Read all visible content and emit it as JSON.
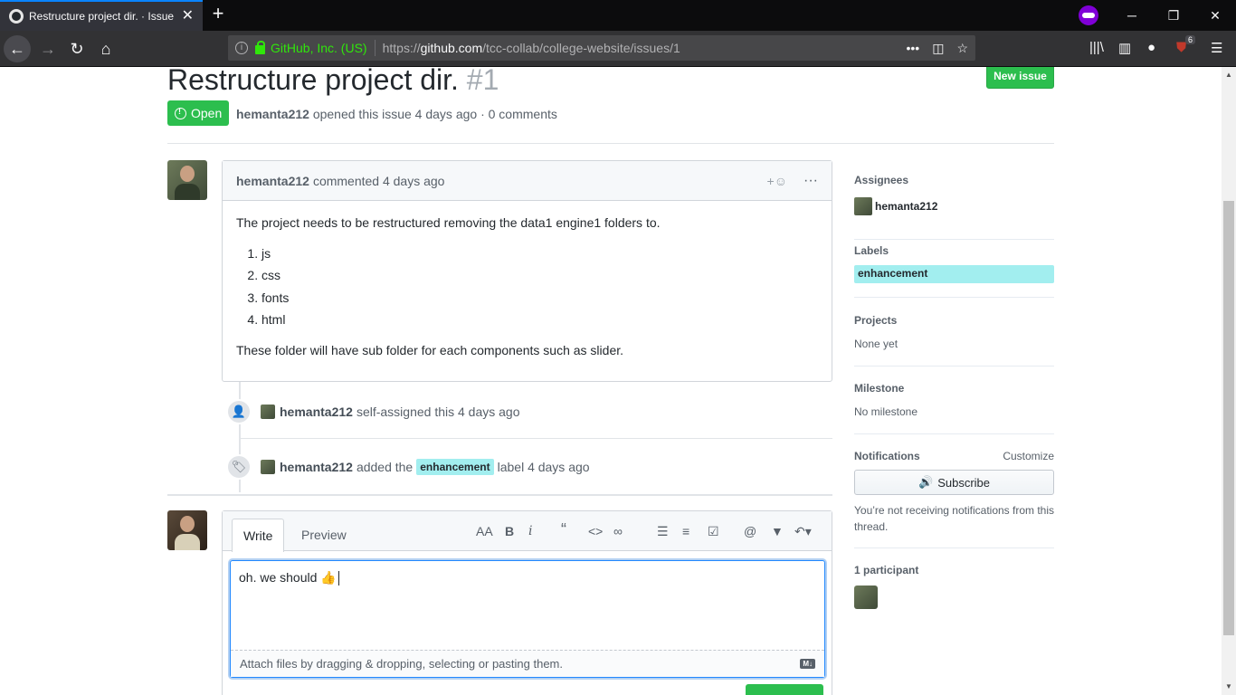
{
  "browser": {
    "tab_title": "Restructure project dir. · Issue #",
    "url_identity": "GitHub, Inc. (US)",
    "url_prefix": "https://",
    "url_host": "github.com",
    "url_path": "/tcc-collab/college-website/issues/1",
    "addon_badge": "6"
  },
  "issue": {
    "title": "Restructure project dir.",
    "number": "#1",
    "new_issue_label": "New issue",
    "state": "Open",
    "author": "hemanta212",
    "meta": "opened this issue 4 days ago · 0 comments"
  },
  "comment": {
    "author": "hemanta212",
    "action": "commented 4 days ago",
    "intro": "The project needs to be restructured removing the data1 engine1 folders to.",
    "items": [
      "js",
      "css",
      "fonts",
      "html"
    ],
    "outro": "These folder will have sub folder for each components such as slider."
  },
  "events": [
    {
      "author": "hemanta212",
      "text": "self-assigned this 4 days ago"
    },
    {
      "author": "hemanta212",
      "pre": "added the",
      "label": "enhancement",
      "post": "label 4 days ago"
    }
  ],
  "composer": {
    "tab_write": "Write",
    "tab_preview": "Preview",
    "text": "oh. we should 👍",
    "attach": "Attach files by dragging & dropping, selecting or pasting them."
  },
  "sidebar": {
    "assignees_title": "Assignees",
    "assignee": "hemanta212",
    "labels_title": "Labels",
    "label": "enhancement",
    "projects_title": "Projects",
    "projects_value": "None yet",
    "milestone_title": "Milestone",
    "milestone_value": "No milestone",
    "notifications_title": "Notifications",
    "customize": "Customize",
    "subscribe": "Subscribe",
    "notif_note": "You’re not receiving notifications from this thread.",
    "participants_title": "1 participant"
  },
  "colors": {
    "green": "#2cbe4e",
    "label": "#a2eeef",
    "private": "#8000d7"
  }
}
